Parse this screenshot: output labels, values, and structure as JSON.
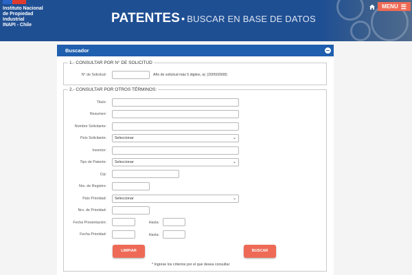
{
  "header": {
    "org_lines": [
      "Instituto Nacional",
      "de Propiedad",
      "Industrial",
      "INAPI - Chile"
    ],
    "title": "PATENTES",
    "separator": "•",
    "subtitle": "BUSCAR EN BASE DE DATOS",
    "home_icon": "home-icon",
    "menu_label": "MENU",
    "menu_icon": "hamburger-icon",
    "colors": {
      "bar": "#1f4f93",
      "menu": "#ef6a55"
    }
  },
  "panel": {
    "title": "Buscador",
    "toggle_icon": "minus-circle-icon",
    "section1": {
      "legend": "1.- CONSULTAR POR N° DE SOLICITUD",
      "field_label": "N° de Solicitud:",
      "field_value": "",
      "hint": "Año de solicitud más 5 digitos, ej: (200502608)"
    },
    "section2": {
      "legend": "2.- CONSULTAR POR OTROS TÉRMINOS:",
      "fields": {
        "titulo": {
          "label": "Titulo:",
          "value": ""
        },
        "resumen": {
          "label": "Resumen:",
          "value": ""
        },
        "solicitante": {
          "label": "Nombre Solicitante:",
          "value": ""
        },
        "pais_solicitante": {
          "label": "País Solicitante:",
          "selected": "Seleccionar"
        },
        "inventor": {
          "label": "Inventor:",
          "value": ""
        },
        "tipo_patente": {
          "label": "Tipo de Patente:",
          "selected": "Seleccionar"
        },
        "cip": {
          "label": "Cip:",
          "value": ""
        },
        "nro_registro": {
          "label": "Nro. de Registro:",
          "value": ""
        },
        "pais_prioridad": {
          "label": "País Prioridad:",
          "selected": "Seleccionar"
        },
        "nro_prioridad": {
          "label": "Nro. de Prioridad:",
          "value": ""
        },
        "fecha_presentacion": {
          "label": "Fecha Presentación:",
          "hasta_label": "Hasta:"
        },
        "fecha_prioridad": {
          "label": "Fecha Prioridad:",
          "hasta_label": "Hasta:"
        }
      },
      "buttons": {
        "clear": "LIMPIAR",
        "search": "BUSCAR"
      },
      "note": "* Ingrese los criterios por el que desea consultar"
    }
  }
}
